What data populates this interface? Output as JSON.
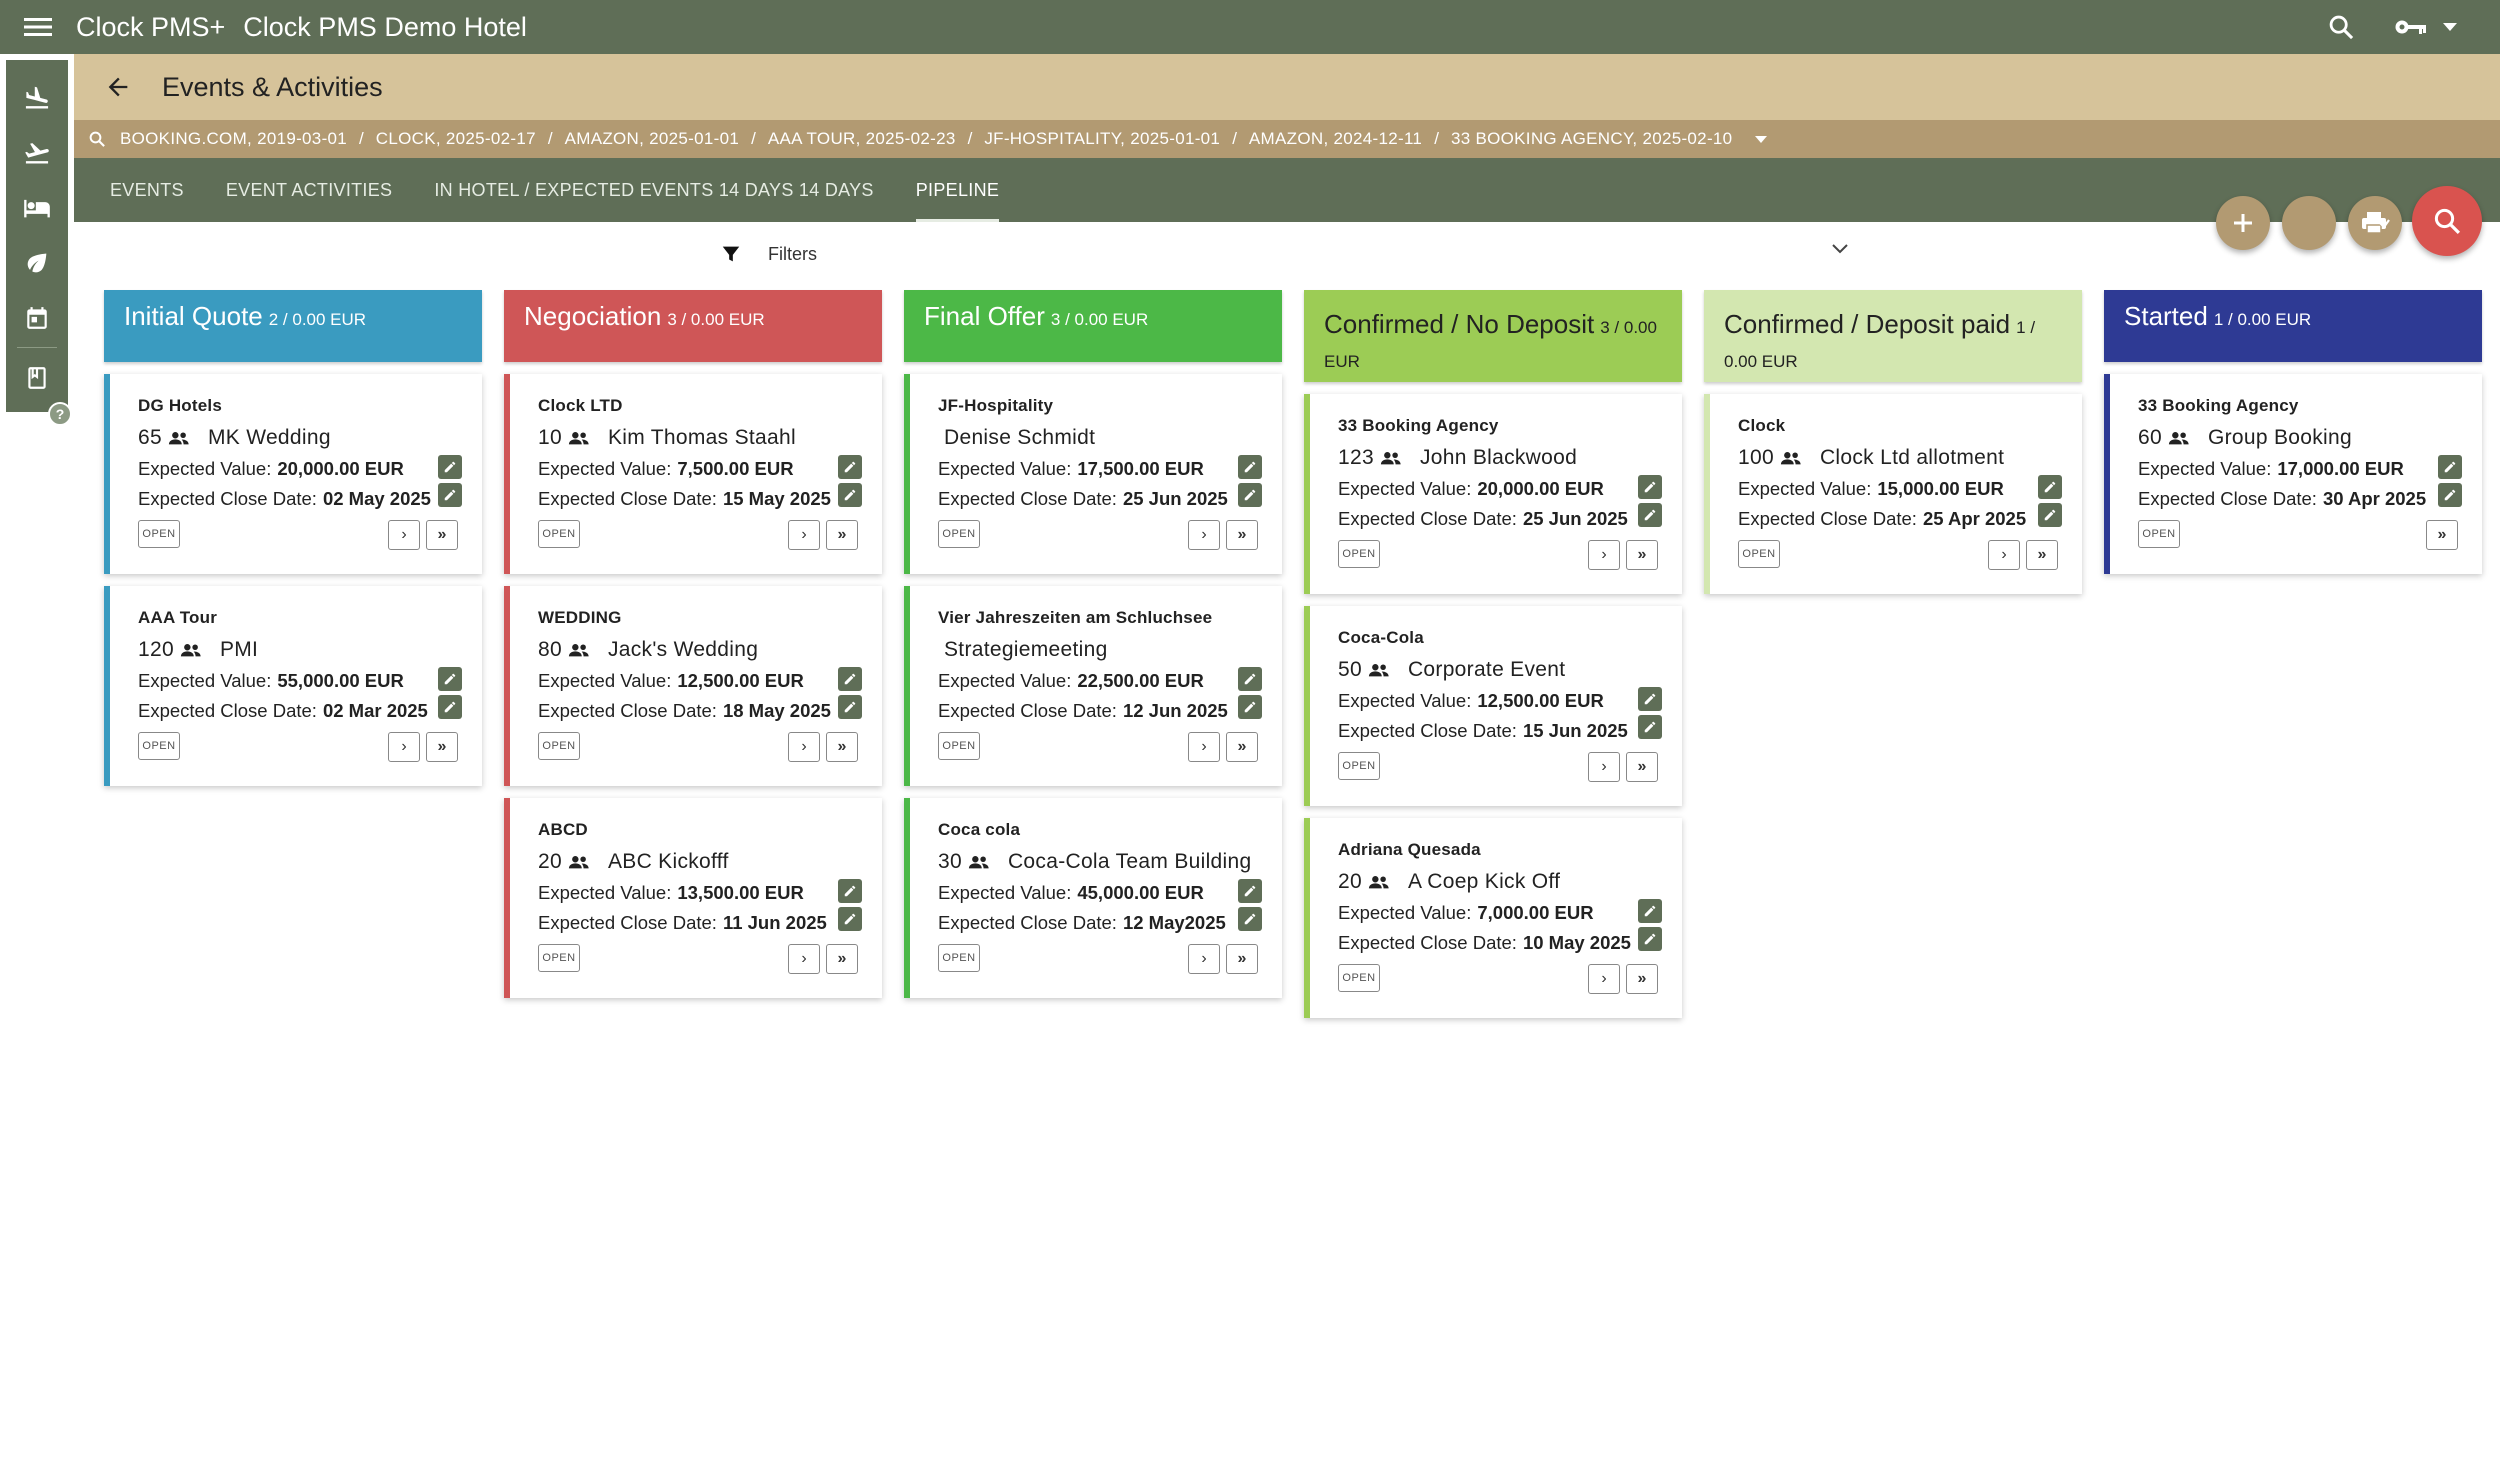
{
  "app": {
    "brand": "Clock PMS+",
    "hotel": "Clock PMS Demo Hotel"
  },
  "page": {
    "title": "Events & Activities"
  },
  "history": [
    "BOOKING.COM, 2019-03-01",
    "CLOCK, 2025-02-17",
    "AMAZON, 2025-01-01",
    "AAA TOUR, 2025-02-23",
    "JF-HOSPITALITY, 2025-01-01",
    "AMAZON, 2024-12-11",
    "33 BOOKING AGENCY, 2025-02-10"
  ],
  "history_separator": "/",
  "tabs": [
    "EVENTS",
    "EVENT ACTIVITIES",
    "IN HOTEL / EXPECTED EVENTS 14 DAYS 14 DAYS",
    "PIPELINE"
  ],
  "active_tab": "PIPELINE",
  "filters": {
    "label": "Filters"
  },
  "labels": {
    "expected_value": "Expected Value:",
    "expected_close": "Expected Close Date:",
    "open": "OPEN"
  },
  "colors": {
    "appbar": "#5f6e57",
    "titlebar": "#d6c39a",
    "historybar": "#b29a72",
    "fab_search": "#d9534f"
  },
  "columns": [
    {
      "title": "Initial Quote",
      "count": "2 / 0.00 EUR",
      "color": "#3a9bc0",
      "dark": false,
      "cards": [
        {
          "company": "DG Hotels",
          "pax": "65",
          "event": "MK Wedding",
          "value": "20,000.00 EUR",
          "close": "02 May 2025",
          "prev": true
        },
        {
          "company": "AAA Tour",
          "pax": "120",
          "event": "PMI",
          "value": "55,000.00 EUR",
          "close": "02 Mar 2025",
          "prev": true
        }
      ]
    },
    {
      "title": "Negociation",
      "count": "3 / 0.00 EUR",
      "color": "#cf5657",
      "dark": false,
      "cards": [
        {
          "company": "Clock LTD",
          "pax": "10",
          "event": "Kim Thomas Staahl",
          "value": "7,500.00 EUR",
          "close": "15 May 2025",
          "prev": true
        },
        {
          "company": "WEDDING",
          "pax": "80",
          "event": "Jack's Wedding",
          "value": "12,500.00 EUR",
          "close": "18 May 2025",
          "prev": true
        },
        {
          "company": "ABCD",
          "pax": "20",
          "event": "ABC Kickofff",
          "value": "13,500.00 EUR",
          "close": "11 Jun 2025",
          "prev": true
        }
      ]
    },
    {
      "title": "Final Offer",
      "count": "3 / 0.00 EUR",
      "color": "#4cb847",
      "dark": false,
      "cards": [
        {
          "company": "JF-Hospitality",
          "pax": "",
          "event": "Denise Schmidt",
          "value": "17,500.00 EUR",
          "close": "25 Jun 2025",
          "prev": true
        },
        {
          "company": "Vier Jahreszeiten am Schluchsee",
          "pax": "",
          "event": "Strategiemeeting",
          "value": "22,500.00 EUR",
          "close": "12 Jun 2025",
          "prev": true
        },
        {
          "company": "Coca cola",
          "pax": "30",
          "event": "Coca-Cola Team Building",
          "value": "45,000.00 EUR",
          "close": "12 May2025",
          "prev": true
        }
      ]
    },
    {
      "title": "Confirmed / No Deposit",
      "count": "3 / 0.00 EUR",
      "color": "#9ccc55",
      "dark": true,
      "cards": [
        {
          "company": "33 Booking Agency",
          "pax": "123",
          "event": "John Blackwood",
          "value": "20,000.00 EUR",
          "close": "25 Jun 2025",
          "prev": true
        },
        {
          "company": "Coca-Cola",
          "pax": "50",
          "event": "Corporate Event",
          "value": "12,500.00 EUR",
          "close": "15 Jun 2025",
          "prev": true
        },
        {
          "company": "Adriana Quesada",
          "pax": "20",
          "event": "A Coep Kick Off",
          "value": "7,000.00 EUR",
          "close": "10 May 2025",
          "prev": true
        }
      ]
    },
    {
      "title": "Confirmed / Deposit paid",
      "count": "1 / 0.00 EUR",
      "color": "#d3e7b0",
      "dark": true,
      "cards": [
        {
          "company": "Clock",
          "pax": "100",
          "event": "Clock Ltd allotment",
          "value": "15,000.00 EUR",
          "close": "25 Apr 2025",
          "prev": true
        }
      ]
    },
    {
      "title": "Started",
      "count": "1 / 0.00 EUR",
      "color": "#2e3a94",
      "dark": false,
      "cards": [
        {
          "company": "33 Booking Agency",
          "pax": "60",
          "event": "Group Booking",
          "value": "17,000.00 EUR",
          "close": "30 Apr 2025",
          "prev": false
        }
      ]
    }
  ]
}
